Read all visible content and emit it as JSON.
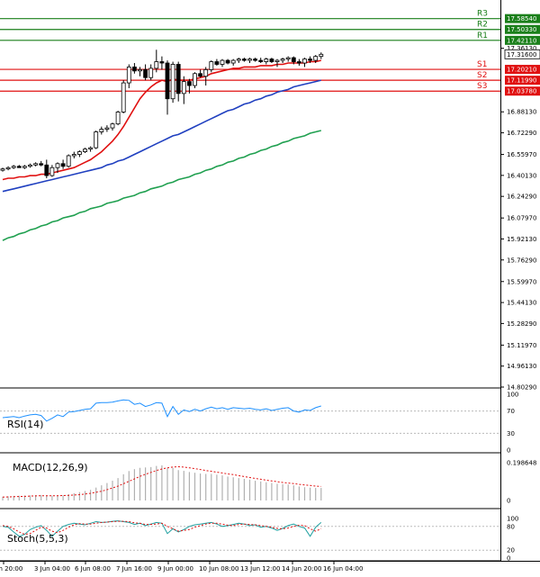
{
  "chart_data": {
    "type": "candlestick",
    "price_axis": {
      "ylim": [
        14.8029,
        17.6647
      ],
      "ticks": [
        17.3613,
        16.8813,
        16.7229,
        16.5597,
        16.4013,
        16.2429,
        16.0797,
        15.9213,
        15.7629,
        15.5997,
        15.4413,
        15.2829,
        15.1197,
        14.9613,
        14.8029
      ],
      "tick_labels": [
        "17.36130",
        "16.88130",
        "16.72290",
        "16.55970",
        "16.40130",
        "16.24290",
        "16.07970",
        "15.92130",
        "15.76290",
        "15.59970",
        "15.44130",
        "15.28290",
        "15.11970",
        "14.96130",
        "14.80290"
      ]
    },
    "current_price": {
      "value": 17.316,
      "label": "17.31600",
      "color": "#000000"
    },
    "levels": [
      {
        "name": "R3",
        "value": 17.5854,
        "label": "17.58540",
        "color": "#1a7f1a"
      },
      {
        "name": "R2",
        "value": 17.5033,
        "label": "17.50330",
        "color": "#1a7f1a"
      },
      {
        "name": "R1",
        "value": 17.4211,
        "label": "17.42110",
        "color": "#1a7f1a"
      },
      {
        "name": "S1",
        "value": 17.2021,
        "label": "17.20210",
        "color": "#e01010"
      },
      {
        "name": "S2",
        "value": 17.1199,
        "label": "17.11990",
        "color": "#e01010"
      },
      {
        "name": "S3",
        "value": 17.0378,
        "label": "17.03780",
        "color": "#e01010"
      }
    ],
    "x_labels": [
      "Jun 20:00",
      "3 Jun 04:00",
      "6 Jun 08:00",
      "7 Jun 16:00",
      "9 Jun 00:00",
      "10 Jun 08:00",
      "13 Jun 12:00",
      "14 Jun 20:00",
      "16 Jun 04:00"
    ],
    "candles": [
      {
        "o": 16.44,
        "h": 16.46,
        "l": 16.43,
        "c": 16.45
      },
      {
        "o": 16.45,
        "h": 16.47,
        "l": 16.44,
        "c": 16.46
      },
      {
        "o": 16.46,
        "h": 16.48,
        "l": 16.45,
        "c": 16.47
      },
      {
        "o": 16.47,
        "h": 16.48,
        "l": 16.46,
        "c": 16.46
      },
      {
        "o": 16.46,
        "h": 16.48,
        "l": 16.45,
        "c": 16.47
      },
      {
        "o": 16.47,
        "h": 16.49,
        "l": 16.46,
        "c": 16.48
      },
      {
        "o": 16.48,
        "h": 16.5,
        "l": 16.47,
        "c": 16.49
      },
      {
        "o": 16.49,
        "h": 16.51,
        "l": 16.47,
        "c": 16.48
      },
      {
        "o": 16.48,
        "h": 16.52,
        "l": 16.38,
        "c": 16.4
      },
      {
        "o": 16.4,
        "h": 16.48,
        "l": 16.39,
        "c": 16.46
      },
      {
        "o": 16.46,
        "h": 16.5,
        "l": 16.42,
        "c": 16.49
      },
      {
        "o": 16.49,
        "h": 16.52,
        "l": 16.45,
        "c": 16.47
      },
      {
        "o": 16.47,
        "h": 16.56,
        "l": 16.46,
        "c": 16.55
      },
      {
        "o": 16.55,
        "h": 16.58,
        "l": 16.53,
        "c": 16.56
      },
      {
        "o": 16.56,
        "h": 16.59,
        "l": 16.54,
        "c": 16.58
      },
      {
        "o": 16.58,
        "h": 16.61,
        "l": 16.57,
        "c": 16.6
      },
      {
        "o": 16.6,
        "h": 16.62,
        "l": 16.58,
        "c": 16.61
      },
      {
        "o": 16.61,
        "h": 16.74,
        "l": 16.6,
        "c": 16.73
      },
      {
        "o": 16.73,
        "h": 16.77,
        "l": 16.71,
        "c": 16.75
      },
      {
        "o": 16.75,
        "h": 16.78,
        "l": 16.73,
        "c": 16.76
      },
      {
        "o": 16.76,
        "h": 16.8,
        "l": 16.74,
        "c": 16.79
      },
      {
        "o": 16.79,
        "h": 16.89,
        "l": 16.78,
        "c": 16.88
      },
      {
        "o": 16.88,
        "h": 17.12,
        "l": 16.87,
        "c": 17.1
      },
      {
        "o": 17.1,
        "h": 17.24,
        "l": 17.06,
        "c": 17.22
      },
      {
        "o": 17.22,
        "h": 17.25,
        "l": 17.17,
        "c": 17.19
      },
      {
        "o": 17.19,
        "h": 17.22,
        "l": 17.15,
        "c": 17.2
      },
      {
        "o": 17.2,
        "h": 17.24,
        "l": 17.12,
        "c": 17.14
      },
      {
        "o": 17.14,
        "h": 17.24,
        "l": 17.12,
        "c": 17.21
      },
      {
        "o": 17.21,
        "h": 17.35,
        "l": 17.18,
        "c": 17.26
      },
      {
        "o": 17.26,
        "h": 17.3,
        "l": 17.2,
        "c": 17.25
      },
      {
        "o": 17.25,
        "h": 17.27,
        "l": 16.86,
        "c": 16.98
      },
      {
        "o": 16.98,
        "h": 17.26,
        "l": 16.95,
        "c": 17.24
      },
      {
        "o": 17.24,
        "h": 17.26,
        "l": 16.96,
        "c": 17.02
      },
      {
        "o": 17.02,
        "h": 17.15,
        "l": 16.94,
        "c": 17.11
      },
      {
        "o": 17.11,
        "h": 17.13,
        "l": 17.02,
        "c": 17.08
      },
      {
        "o": 17.08,
        "h": 17.18,
        "l": 17.06,
        "c": 17.17
      },
      {
        "o": 17.17,
        "h": 17.2,
        "l": 17.14,
        "c": 17.15
      },
      {
        "o": 17.15,
        "h": 17.22,
        "l": 17.08,
        "c": 17.2
      },
      {
        "o": 17.2,
        "h": 17.27,
        "l": 17.18,
        "c": 17.26
      },
      {
        "o": 17.26,
        "h": 17.28,
        "l": 17.23,
        "c": 17.24
      },
      {
        "o": 17.24,
        "h": 17.28,
        "l": 17.22,
        "c": 17.27
      },
      {
        "o": 17.27,
        "h": 17.28,
        "l": 17.24,
        "c": 17.25
      },
      {
        "o": 17.25,
        "h": 17.28,
        "l": 17.23,
        "c": 17.27
      },
      {
        "o": 17.27,
        "h": 17.29,
        "l": 17.25,
        "c": 17.28
      },
      {
        "o": 17.28,
        "h": 17.29,
        "l": 17.26,
        "c": 17.27
      },
      {
        "o": 17.27,
        "h": 17.29,
        "l": 17.25,
        "c": 17.28
      },
      {
        "o": 17.28,
        "h": 17.29,
        "l": 17.26,
        "c": 17.27
      },
      {
        "o": 17.27,
        "h": 17.29,
        "l": 17.25,
        "c": 17.26
      },
      {
        "o": 17.26,
        "h": 17.29,
        "l": 17.24,
        "c": 17.28
      },
      {
        "o": 17.28,
        "h": 17.29,
        "l": 17.25,
        "c": 17.26
      },
      {
        "o": 17.26,
        "h": 17.28,
        "l": 17.22,
        "c": 17.27
      },
      {
        "o": 17.27,
        "h": 17.29,
        "l": 17.25,
        "c": 17.28
      },
      {
        "o": 17.28,
        "h": 17.3,
        "l": 17.26,
        "c": 17.29
      },
      {
        "o": 17.29,
        "h": 17.3,
        "l": 17.24,
        "c": 17.26
      },
      {
        "o": 17.26,
        "h": 17.28,
        "l": 17.23,
        "c": 17.25
      },
      {
        "o": 17.25,
        "h": 17.29,
        "l": 17.22,
        "c": 17.28
      },
      {
        "o": 17.28,
        "h": 17.3,
        "l": 17.25,
        "c": 17.27
      },
      {
        "o": 17.27,
        "h": 17.31,
        "l": 17.25,
        "c": 17.3
      },
      {
        "o": 17.3,
        "h": 17.33,
        "l": 17.28,
        "c": 17.316
      }
    ],
    "ma_series": [
      {
        "color": "#e01010",
        "values": [
          16.37,
          16.38,
          16.38,
          16.39,
          16.39,
          16.4,
          16.4,
          16.41,
          16.41,
          16.42,
          16.43,
          16.44,
          16.45,
          16.46,
          16.48,
          16.5,
          16.52,
          16.55,
          16.58,
          16.62,
          16.66,
          16.71,
          16.77,
          16.84,
          16.91,
          16.98,
          17.03,
          17.07,
          17.1,
          17.12,
          17.11,
          17.13,
          17.12,
          17.12,
          17.12,
          17.13,
          17.14,
          17.15,
          17.17,
          17.18,
          17.19,
          17.2,
          17.21,
          17.21,
          17.22,
          17.22,
          17.22,
          17.23,
          17.23,
          17.23,
          17.24,
          17.24,
          17.25,
          17.25,
          17.25,
          17.25,
          17.26,
          17.26,
          17.27
        ]
      },
      {
        "color": "#2040c0",
        "values": [
          16.28,
          16.29,
          16.3,
          16.31,
          16.32,
          16.33,
          16.34,
          16.35,
          16.36,
          16.37,
          16.38,
          16.39,
          16.4,
          16.41,
          16.42,
          16.43,
          16.44,
          16.45,
          16.46,
          16.48,
          16.49,
          16.51,
          16.52,
          16.54,
          16.56,
          16.58,
          16.6,
          16.62,
          16.64,
          16.66,
          16.68,
          16.7,
          16.71,
          16.73,
          16.75,
          16.77,
          16.79,
          16.81,
          16.83,
          16.85,
          16.87,
          16.89,
          16.9,
          16.92,
          16.94,
          16.95,
          16.97,
          16.98,
          17.0,
          17.01,
          17.03,
          17.04,
          17.05,
          17.07,
          17.08,
          17.09,
          17.1,
          17.11,
          17.12
        ]
      },
      {
        "color": "#20a050",
        "values": [
          15.91,
          15.93,
          15.94,
          15.96,
          15.97,
          15.99,
          16.0,
          16.02,
          16.03,
          16.05,
          16.06,
          16.08,
          16.09,
          16.1,
          16.12,
          16.13,
          16.15,
          16.16,
          16.17,
          16.19,
          16.2,
          16.21,
          16.23,
          16.24,
          16.25,
          16.27,
          16.28,
          16.3,
          16.31,
          16.32,
          16.34,
          16.35,
          16.37,
          16.38,
          16.39,
          16.41,
          16.42,
          16.44,
          16.45,
          16.47,
          16.48,
          16.5,
          16.51,
          16.53,
          16.54,
          16.56,
          16.57,
          16.59,
          16.6,
          16.62,
          16.63,
          16.65,
          16.66,
          16.68,
          16.69,
          16.7,
          16.72,
          16.73,
          16.74
        ]
      }
    ],
    "rsi": {
      "label": "RSI(14)",
      "ylim": [
        0,
        100
      ],
      "ticks": [
        100,
        70,
        30,
        0
      ],
      "tick_labels": [
        "100",
        "70",
        "30",
        "0"
      ],
      "values": [
        58,
        59,
        60,
        58,
        61,
        63,
        64,
        62,
        52,
        57,
        63,
        60,
        68,
        69,
        71,
        73,
        74,
        84,
        85,
        85,
        86,
        88,
        90,
        89,
        82,
        84,
        78,
        81,
        85,
        84,
        60,
        78,
        64,
        72,
        69,
        73,
        70,
        74,
        77,
        74,
        76,
        73,
        76,
        75,
        74,
        75,
        73,
        72,
        74,
        71,
        73,
        75,
        76,
        70,
        68,
        72,
        71,
        76,
        79
      ]
    },
    "macd": {
      "label": "MACD(12,26,9)",
      "ylim": [
        0,
        0.2086
      ],
      "ticks": [
        0.198648,
        0
      ],
      "tick_labels": [
        "0.198648",
        "0"
      ],
      "histogram": [
        0.02,
        0.022,
        0.024,
        0.025,
        0.026,
        0.027,
        0.028,
        0.029,
        0.027,
        0.026,
        0.027,
        0.028,
        0.033,
        0.038,
        0.044,
        0.05,
        0.056,
        0.068,
        0.08,
        0.092,
        0.104,
        0.118,
        0.138,
        0.155,
        0.165,
        0.172,
        0.174,
        0.176,
        0.182,
        0.185,
        0.17,
        0.172,
        0.16,
        0.156,
        0.15,
        0.146,
        0.142,
        0.14,
        0.14,
        0.136,
        0.132,
        0.126,
        0.122,
        0.118,
        0.114,
        0.11,
        0.104,
        0.1,
        0.096,
        0.092,
        0.088,
        0.086,
        0.084,
        0.08,
        0.074,
        0.07,
        0.068,
        0.066,
        0.066
      ],
      "signal": [
        0.018,
        0.019,
        0.02,
        0.021,
        0.022,
        0.023,
        0.024,
        0.025,
        0.025,
        0.025,
        0.025,
        0.026,
        0.027,
        0.029,
        0.031,
        0.034,
        0.038,
        0.043,
        0.049,
        0.057,
        0.066,
        0.076,
        0.088,
        0.101,
        0.114,
        0.127,
        0.138,
        0.148,
        0.158,
        0.166,
        0.172,
        0.176,
        0.178,
        0.176,
        0.172,
        0.168,
        0.163,
        0.158,
        0.154,
        0.149,
        0.145,
        0.14,
        0.136,
        0.131,
        0.126,
        0.121,
        0.116,
        0.112,
        0.107,
        0.103,
        0.099,
        0.095,
        0.092,
        0.089,
        0.085,
        0.082,
        0.079,
        0.076,
        0.074
      ]
    },
    "stoch": {
      "label": "Stoch(5,5,3)",
      "ylim": [
        0,
        100
      ],
      "ticks": [
        100,
        80,
        20,
        0
      ],
      "tick_labels": [
        "100",
        "80",
        "20",
        "0"
      ],
      "main": [
        80,
        78,
        66,
        55,
        60,
        72,
        78,
        82,
        70,
        55,
        68,
        80,
        85,
        88,
        86,
        84,
        88,
        92,
        90,
        91,
        93,
        94,
        92,
        90,
        85,
        88,
        82,
        86,
        90,
        88,
        62,
        74,
        66,
        72,
        80,
        84,
        86,
        88,
        90,
        86,
        80,
        82,
        85,
        88,
        86,
        82,
        84,
        78,
        80,
        76,
        70,
        75,
        82,
        86,
        80,
        76,
        55,
        78,
        90
      ],
      "signal": [
        82,
        80,
        74,
        66,
        60,
        62,
        70,
        78,
        76,
        68,
        64,
        70,
        78,
        84,
        87,
        86,
        86,
        88,
        90,
        91,
        92,
        93,
        93,
        92,
        89,
        88,
        85,
        85,
        86,
        88,
        80,
        74,
        68,
        70,
        72,
        78,
        82,
        86,
        88,
        88,
        86,
        83,
        82,
        85,
        86,
        85,
        84,
        82,
        80,
        78,
        75,
        74,
        76,
        80,
        83,
        82,
        74,
        68,
        74
      ]
    }
  }
}
